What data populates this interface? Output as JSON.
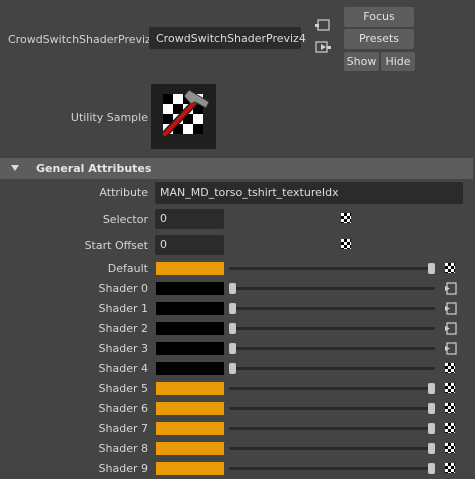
{
  "header": {
    "node_type_label": "CrowdSwitchShaderPreviz:",
    "node_name": "CrowdSwitchShaderPreviz4",
    "focus_label": "Focus",
    "presets_label": "Presets",
    "show_label": "Show",
    "hide_label": "Hide",
    "utility_sample_label": "Utility Sample"
  },
  "section": {
    "title": "General Attributes"
  },
  "attributes": {
    "attribute_label": "Attribute",
    "attribute_value": "MAN_MD_torso_tshirt_textureIdx",
    "selector_label": "Selector",
    "selector_value": "0",
    "start_offset_label": "Start Offset",
    "start_offset_value": "0"
  },
  "colors": {
    "orange": "#e79b07",
    "black": "#000000"
  },
  "shaders": [
    {
      "label": "Default",
      "color": "orange",
      "slider": 1.0,
      "icon": "checker-icon"
    },
    {
      "label": "Shader 0",
      "color": "black",
      "slider": 0.0,
      "icon": "map-connection-icon"
    },
    {
      "label": "Shader 1",
      "color": "black",
      "slider": 0.0,
      "icon": "map-connection-icon"
    },
    {
      "label": "Shader 2",
      "color": "black",
      "slider": 0.0,
      "icon": "map-connection-icon"
    },
    {
      "label": "Shader 3",
      "color": "black",
      "slider": 0.0,
      "icon": "map-connection-icon"
    },
    {
      "label": "Shader 4",
      "color": "black",
      "slider": 0.0,
      "icon": "checker-icon"
    },
    {
      "label": "Shader 5",
      "color": "orange",
      "slider": 1.0,
      "icon": "checker-icon"
    },
    {
      "label": "Shader 6",
      "color": "orange",
      "slider": 1.0,
      "icon": "checker-icon"
    },
    {
      "label": "Shader 7",
      "color": "orange",
      "slider": 1.0,
      "icon": "checker-icon"
    },
    {
      "label": "Shader 8",
      "color": "orange",
      "slider": 1.0,
      "icon": "checker-icon"
    },
    {
      "label": "Shader 9",
      "color": "orange",
      "slider": 1.0,
      "icon": "checker-icon"
    }
  ]
}
